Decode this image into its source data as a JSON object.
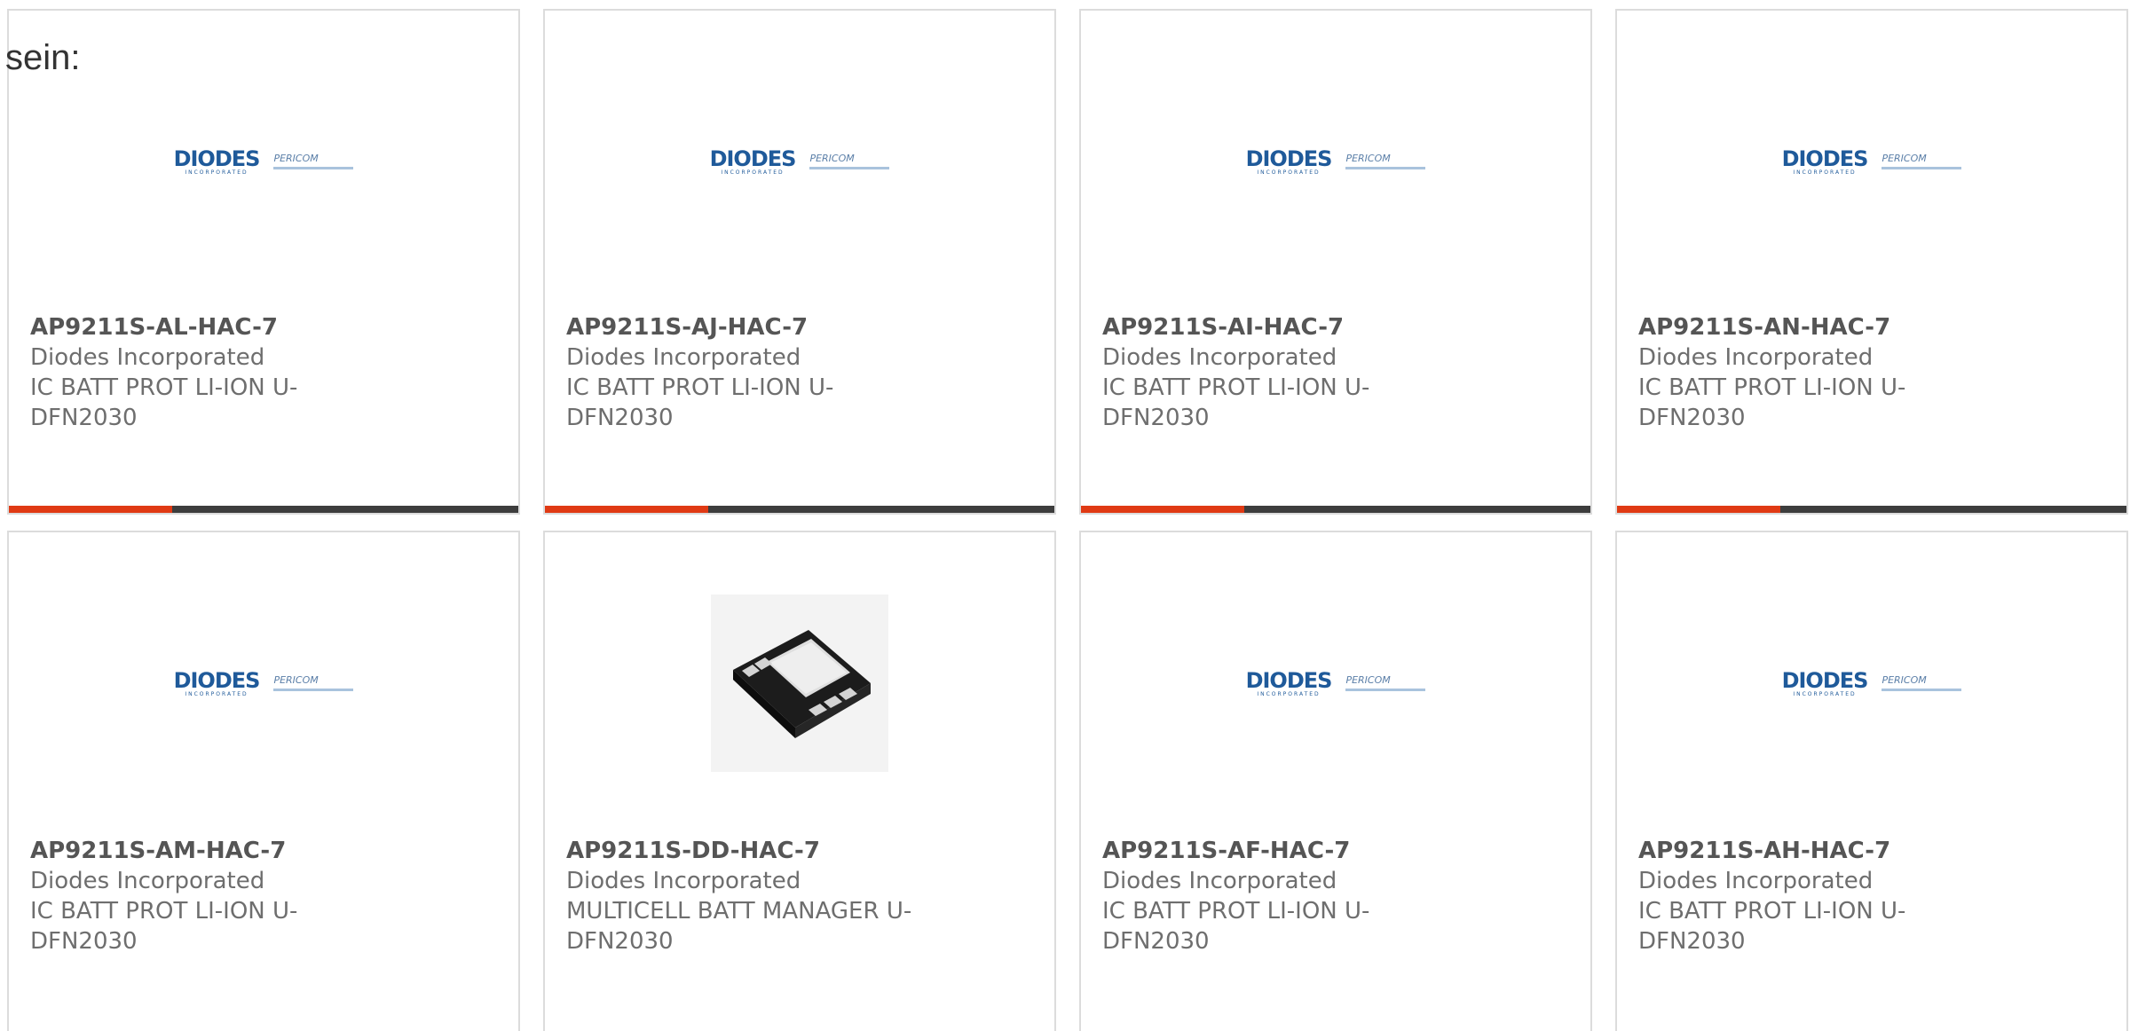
{
  "intro_text": "sein:",
  "colors": {
    "accent": "#e03a14",
    "progress_track": "#3d3d3d",
    "brand_blue": "#1f5a9a"
  },
  "logo": {
    "main": "DIODES",
    "sub": "INCORPORATED",
    "secondary": "PERICOM"
  },
  "cards": [
    {
      "part_number": "AP9211S-AL-HAC-7",
      "manufacturer": "Diodes Incorporated",
      "description": "IC BATT PROT LI-ION U-DFN2030",
      "image": "diodes-pericom-logo",
      "progress": 0.32
    },
    {
      "part_number": "AP9211S-AJ-HAC-7",
      "manufacturer": "Diodes Incorporated",
      "description": "IC BATT PROT LI-ION U-DFN2030",
      "image": "diodes-pericom-logo",
      "progress": 0.32
    },
    {
      "part_number": "AP9211S-AI-HAC-7",
      "manufacturer": "Diodes Incorporated",
      "description": "IC BATT PROT LI-ION U-DFN2030",
      "image": "diodes-pericom-logo",
      "progress": 0.32
    },
    {
      "part_number": "AP9211S-AN-HAC-7",
      "manufacturer": "Diodes Incorporated",
      "description": "IC BATT PROT LI-ION U-DFN2030",
      "image": "diodes-pericom-logo",
      "progress": 0.32
    },
    {
      "part_number": "AP9211S-AM-HAC-7",
      "manufacturer": "Diodes Incorporated",
      "description": "IC BATT PROT LI-ION U-DFN2030",
      "image": "diodes-pericom-logo"
    },
    {
      "part_number": "AP9211S-DD-HAC-7",
      "manufacturer": "Diodes Incorporated",
      "description": "MULTICELL BATT MANAGER U-DFN2030",
      "image": "dfn-chip-package"
    },
    {
      "part_number": "AP9211S-AF-HAC-7",
      "manufacturer": "Diodes Incorporated",
      "description": "IC BATT PROT LI-ION U-DFN2030",
      "image": "diodes-pericom-logo"
    },
    {
      "part_number": "AP9211S-AH-HAC-7",
      "manufacturer": "Diodes Incorporated",
      "description": "IC BATT PROT LI-ION U-DFN2030",
      "image": "diodes-pericom-logo"
    }
  ]
}
